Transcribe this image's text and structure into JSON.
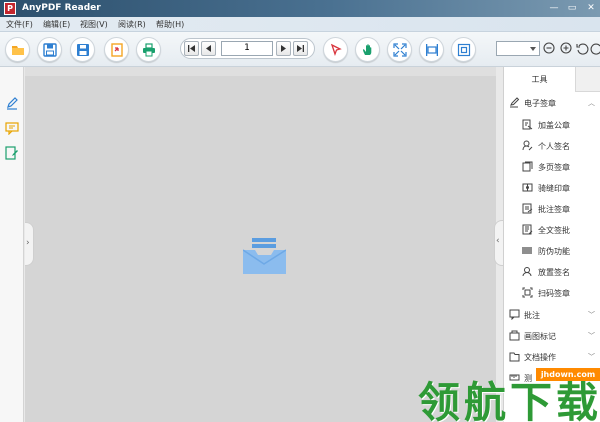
{
  "window": {
    "title": "AnyPDF Reader",
    "logo_text": "P",
    "controls": {
      "minimize": "—",
      "restore": "▭",
      "close": "✕"
    }
  },
  "menubar": {
    "items": [
      "文件(F)",
      "编辑(E)",
      "视图(V)",
      "阅读(R)",
      "帮助(H)"
    ]
  },
  "toolbar": {
    "buttons": [
      "open-folder-icon",
      "save-icon",
      "save-as-icon",
      "export-icon",
      "print-icon"
    ],
    "page_number": "1",
    "nav": [
      "first-page-icon",
      "prev-page-icon",
      "next-page-icon",
      "last-page-icon"
    ],
    "tools": [
      "select-cursor-icon",
      "hand-icon",
      "fit-page-icon",
      "fit-width-icon",
      "actual-size-icon"
    ],
    "zoom_value": "",
    "accent_colors": {
      "orange": "#f5a623",
      "blue": "#2e7fd1",
      "red": "#d9363e",
      "green": "#1aa06d"
    }
  },
  "left_strip": {
    "icons": [
      "pen-sign-icon",
      "comment-icon",
      "document-edit-icon"
    ]
  },
  "document": {
    "empty_icon": "empty-tray-icon"
  },
  "right_panel": {
    "tab": "工具",
    "sections": [
      {
        "label": "电子签章",
        "icon": "signature-icon",
        "expanded": true,
        "items": [
          {
            "label": "加盖公章",
            "icon": "stamp-icon"
          },
          {
            "label": "个人签名",
            "icon": "person-sign-icon"
          },
          {
            "label": "多页签章",
            "icon": "multi-page-icon"
          },
          {
            "label": "骑缝印章",
            "icon": "seam-stamp-icon"
          },
          {
            "label": "批注签章",
            "icon": "annotation-stamp-icon"
          },
          {
            "label": "全文签批",
            "icon": "full-text-sign-icon"
          },
          {
            "label": "防伪功能",
            "icon": "anti-fake-icon"
          },
          {
            "label": "放置签名",
            "icon": "place-sign-icon"
          },
          {
            "label": "扫码签章",
            "icon": "scan-code-icon"
          }
        ]
      },
      {
        "label": "批注",
        "icon": "comment-icon",
        "expanded": false
      },
      {
        "label": "画图标记",
        "icon": "drawing-icon",
        "expanded": false
      },
      {
        "label": "文档操作",
        "icon": "folder-icon",
        "expanded": false
      },
      {
        "label": "测",
        "icon": "measure-icon",
        "expanded": false
      }
    ]
  },
  "watermark": {
    "site": "jhdown.com",
    "text": "领航下载"
  }
}
